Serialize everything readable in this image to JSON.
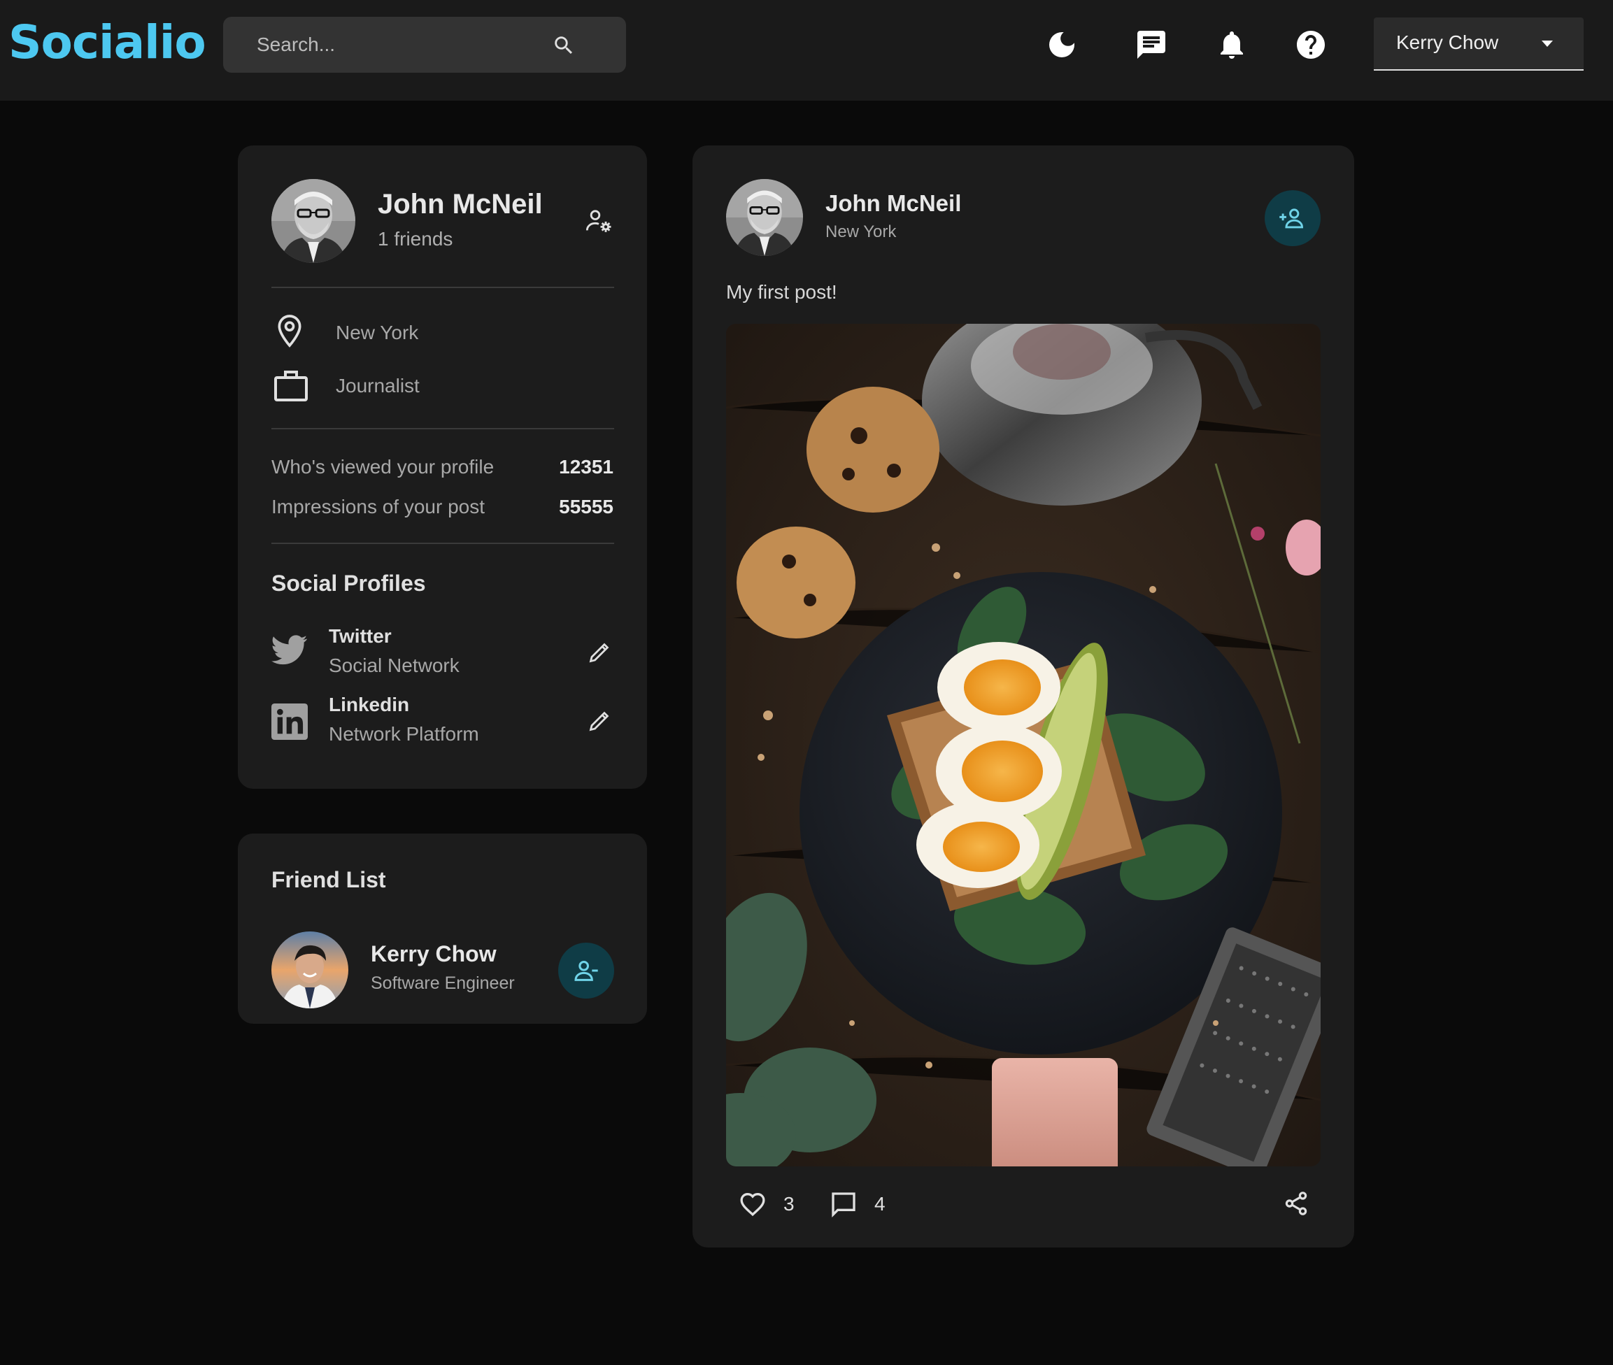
{
  "navbar": {
    "logo": "Socialio",
    "search_placeholder": "Search...",
    "icons": [
      "search-icon",
      "dark-mode-moon-icon",
      "messages-icon",
      "notifications-bell-icon",
      "help-icon"
    ],
    "user_select_value": "Kerry Chow"
  },
  "profile": {
    "name": "John McNeil",
    "friends": "1 friends",
    "location": "New York",
    "occupation": "Journalist",
    "stats": [
      {
        "label": "Who's viewed your profile",
        "value": "12351"
      },
      {
        "label": "Impressions of your post",
        "value": "55555"
      }
    ],
    "social_title": "Social Profiles",
    "socials": [
      {
        "name": "Twitter",
        "type": "Social Network",
        "icon": "twitter-icon"
      },
      {
        "name": "Linkedin",
        "type": "Network Platform",
        "icon": "linkedin-icon"
      }
    ]
  },
  "friends": {
    "title": "Friend List",
    "items": [
      {
        "name": "Kerry Chow",
        "role": "Software Engineer"
      }
    ]
  },
  "post": {
    "author": "John McNeil",
    "location": "New York",
    "text": "My first post!",
    "likes": "3",
    "comments": "4"
  },
  "colors": {
    "brand": "#4dc8f0",
    "background": "#0a0a0a",
    "card": "#1c1c1c",
    "navbar": "#1a1a1a",
    "accent_button": "#0f3c46",
    "accent_icon": "#6fd3e8"
  }
}
